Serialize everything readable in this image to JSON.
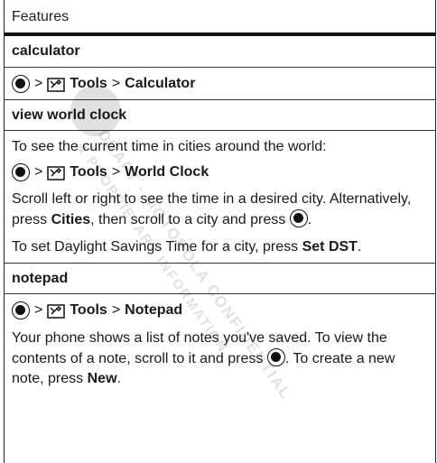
{
  "header": {
    "title": "Features"
  },
  "calculator": {
    "title": "calculator",
    "nav": {
      "tools": "Tools",
      "sep": ">",
      "target": "Calculator"
    }
  },
  "world_clock": {
    "title": "view world clock",
    "intro": "To see the current time in cities around the world:",
    "nav": {
      "tools": "Tools",
      "sep": ">",
      "target": "World Clock"
    },
    "p1_a": "Scroll left or right to see the time in a desired city. Alternatively, press ",
    "p1_cities": "Cities",
    "p1_b": ", then scroll to a city and press ",
    "p1_c": ".",
    "p2_a": "To set Daylight Savings Time for a city, press ",
    "p2_setdst": "Set DST",
    "p2_b": "."
  },
  "notepad": {
    "title": "notepad",
    "nav": {
      "tools": "Tools",
      "sep": ">",
      "target": "Notepad"
    },
    "p_a": "Your phone shows a list of notes you've saved. To view the contents of a note, scroll to it and press ",
    "p_b": ". To create a new note, press ",
    "p_new": "New",
    "p_c": "."
  },
  "watermark": {
    "line1": "DRAFT - MOTOROLA CONFIDENTIAL",
    "line2": "& PROPRIETARY INFORMATION"
  },
  "icons": {
    "center_key": "center-select-key-icon",
    "tools": "tools-icon"
  }
}
